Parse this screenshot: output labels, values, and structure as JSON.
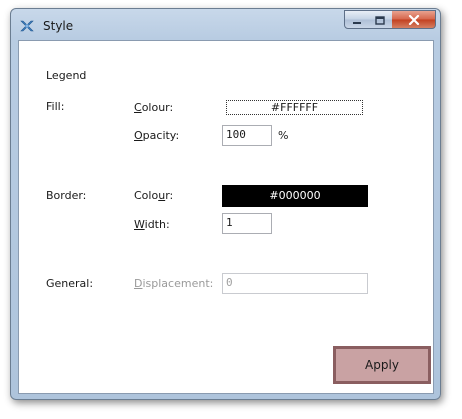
{
  "window": {
    "title": "Style",
    "controls": {
      "minimize_icon": "minimize-icon",
      "maximize_icon": "maximize-icon",
      "close_icon": "close-icon"
    },
    "app_icon": "app-icon"
  },
  "section": {
    "heading": "Legend"
  },
  "fill": {
    "group_label": "Fill:",
    "colour_label_pre": "",
    "colour_label_key": "C",
    "colour_label_post": "olour:",
    "colour_value": "#FFFFFF",
    "colour_swatch": "#FFFFFF",
    "opacity_label_key": "O",
    "opacity_label_post": "pacity:",
    "opacity_value": "100",
    "opacity_unit": "%"
  },
  "border": {
    "group_label": "Border:",
    "colour_label_pre": "Colo",
    "colour_label_key": "u",
    "colour_label_post": "r:",
    "colour_value": "#000000",
    "colour_swatch": "#000000",
    "width_label_key": "W",
    "width_label_post": "idth:",
    "width_value": "1"
  },
  "general": {
    "group_label": "General:",
    "displacement_label_key": "D",
    "displacement_label_post": "isplacement:",
    "displacement_value": "0"
  },
  "actions": {
    "apply_label": "Apply"
  }
}
